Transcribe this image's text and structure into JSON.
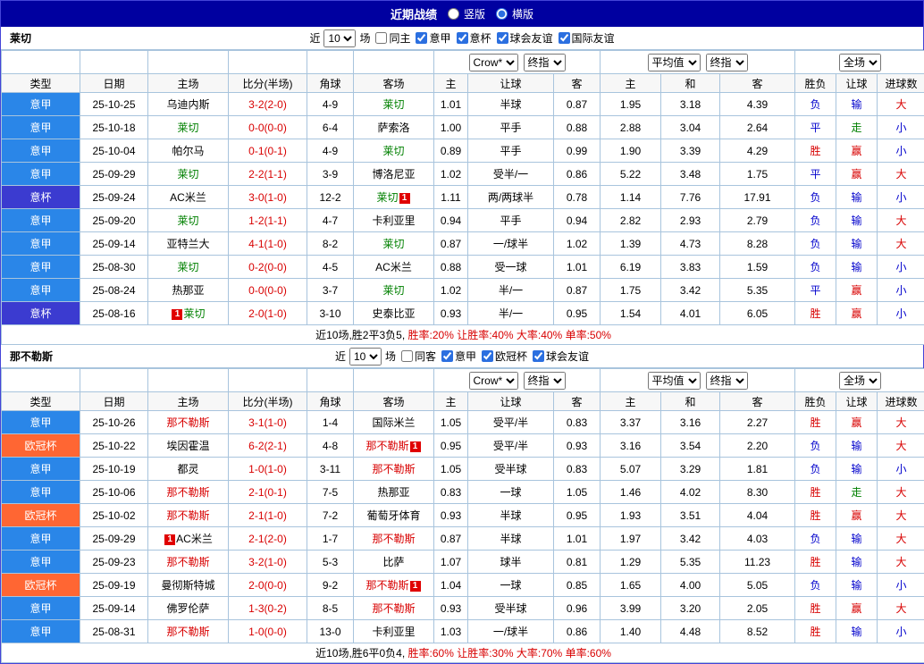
{
  "titlebar": {
    "title": "近期战绩",
    "radios": [
      {
        "label": "竖版",
        "checked": false
      },
      {
        "label": "横版",
        "checked": true
      }
    ]
  },
  "header": {
    "left_cols": [
      "类型",
      "日期",
      "主场",
      "比分(半场)",
      "角球",
      "客场"
    ],
    "select_groups": [
      [
        "Crow*",
        "终指"
      ],
      [
        "平均值",
        "终指"
      ],
      [
        "全场"
      ]
    ],
    "sub_cols": [
      "主",
      "让球",
      "客",
      "主",
      "和",
      "客",
      "胜负",
      "让球",
      "进球数"
    ]
  },
  "colors": {
    "accent_navy": "#0000a0",
    "serie_a_blue": "#2a86e8",
    "coppa_indigo": "#3b3bd0",
    "ucl_orange": "#ff6633",
    "win_red": "#d80000",
    "lose_blue": "#0000cc",
    "team_green": "#008000"
  },
  "sections": [
    {
      "team": "莱切",
      "filter": {
        "near": "近",
        "count": "10",
        "games": "场",
        "checks": [
          {
            "label": "同主",
            "checked": false
          },
          {
            "label": "意甲",
            "checked": true
          },
          {
            "label": "意杯",
            "checked": true
          },
          {
            "label": "球会友谊",
            "checked": true
          },
          {
            "label": "国际友谊",
            "checked": true
          }
        ]
      },
      "rows": [
        {
          "lg": "意甲",
          "date": "25-10-25",
          "home": {
            "n": "乌迪内斯",
            "c": "k"
          },
          "score": "3-2(2-0)",
          "cor": "4-9",
          "away": {
            "n": "莱切",
            "c": "g"
          },
          "o": [
            "1.01",
            "半球",
            "0.87"
          ],
          "avg": [
            "1.95",
            "3.18",
            "4.39"
          ],
          "res": [
            "负",
            "b"
          ],
          "hc": [
            "输",
            "b"
          ],
          "ou": [
            "大",
            "r"
          ]
        },
        {
          "lg": "意甲",
          "date": "25-10-18",
          "home": {
            "n": "莱切",
            "c": "g"
          },
          "score": "0-0(0-0)",
          "cor": "6-4",
          "away": {
            "n": "萨索洛",
            "c": "k"
          },
          "o": [
            "1.00",
            "平手",
            "0.88"
          ],
          "avg": [
            "2.88",
            "3.04",
            "2.64"
          ],
          "res": [
            "平",
            "b"
          ],
          "hc": [
            "走",
            "g"
          ],
          "ou": [
            "小",
            "b"
          ]
        },
        {
          "lg": "意甲",
          "date": "25-10-04",
          "home": {
            "n": "帕尔马",
            "c": "k"
          },
          "score": "0-1(0-1)",
          "cor": "4-9",
          "away": {
            "n": "莱切",
            "c": "g"
          },
          "o": [
            "0.89",
            "平手",
            "0.99"
          ],
          "avg": [
            "1.90",
            "3.39",
            "4.29"
          ],
          "res": [
            "胜",
            "r"
          ],
          "hc": [
            "赢",
            "r"
          ],
          "ou": [
            "小",
            "b"
          ]
        },
        {
          "lg": "意甲",
          "date": "25-09-29",
          "home": {
            "n": "莱切",
            "c": "g"
          },
          "score": "2-2(1-1)",
          "cor": "3-9",
          "away": {
            "n": "博洛尼亚",
            "c": "k"
          },
          "o": [
            "1.02",
            "受半/一",
            "0.86"
          ],
          "avg": [
            "5.22",
            "3.48",
            "1.75"
          ],
          "res": [
            "平",
            "b"
          ],
          "hc": [
            "赢",
            "r"
          ],
          "ou": [
            "大",
            "r"
          ]
        },
        {
          "lg": "意杯",
          "date": "25-09-24",
          "home": {
            "n": "AC米兰",
            "c": "k"
          },
          "score": "3-0(1-0)",
          "cor": "12-2",
          "away": {
            "n": "莱切",
            "c": "g",
            "badge": "1",
            "bpos": "after"
          },
          "o": [
            "1.11",
            "两/两球半",
            "0.78"
          ],
          "avg": [
            "1.14",
            "7.76",
            "17.91"
          ],
          "res": [
            "负",
            "b"
          ],
          "hc": [
            "输",
            "b"
          ],
          "ou": [
            "小",
            "b"
          ]
        },
        {
          "lg": "意甲",
          "date": "25-09-20",
          "home": {
            "n": "莱切",
            "c": "g"
          },
          "score": "1-2(1-1)",
          "cor": "4-7",
          "away": {
            "n": "卡利亚里",
            "c": "k"
          },
          "o": [
            "0.94",
            "平手",
            "0.94"
          ],
          "avg": [
            "2.82",
            "2.93",
            "2.79"
          ],
          "res": [
            "负",
            "b"
          ],
          "hc": [
            "输",
            "b"
          ],
          "ou": [
            "大",
            "r"
          ]
        },
        {
          "lg": "意甲",
          "date": "25-09-14",
          "home": {
            "n": "亚特兰大",
            "c": "k"
          },
          "score": "4-1(1-0)",
          "cor": "8-2",
          "away": {
            "n": "莱切",
            "c": "g"
          },
          "o": [
            "0.87",
            "一/球半",
            "1.02"
          ],
          "avg": [
            "1.39",
            "4.73",
            "8.28"
          ],
          "res": [
            "负",
            "b"
          ],
          "hc": [
            "输",
            "b"
          ],
          "ou": [
            "大",
            "r"
          ]
        },
        {
          "lg": "意甲",
          "date": "25-08-30",
          "home": {
            "n": "莱切",
            "c": "g"
          },
          "score": "0-2(0-0)",
          "cor": "4-5",
          "away": {
            "n": "AC米兰",
            "c": "k"
          },
          "o": [
            "0.88",
            "受一球",
            "1.01"
          ],
          "avg": [
            "6.19",
            "3.83",
            "1.59"
          ],
          "res": [
            "负",
            "b"
          ],
          "hc": [
            "输",
            "b"
          ],
          "ou": [
            "小",
            "b"
          ]
        },
        {
          "lg": "意甲",
          "date": "25-08-24",
          "home": {
            "n": "热那亚",
            "c": "k"
          },
          "score": "0-0(0-0)",
          "cor": "3-7",
          "away": {
            "n": "莱切",
            "c": "g"
          },
          "o": [
            "1.02",
            "半/一",
            "0.87"
          ],
          "avg": [
            "1.75",
            "3.42",
            "5.35"
          ],
          "res": [
            "平",
            "b"
          ],
          "hc": [
            "赢",
            "r"
          ],
          "ou": [
            "小",
            "b"
          ]
        },
        {
          "lg": "意杯",
          "date": "25-08-16",
          "home": {
            "n": "莱切",
            "c": "g",
            "badge": "1",
            "bpos": "before"
          },
          "score": "2-0(1-0)",
          "cor": "3-10",
          "away": {
            "n": "史泰比亚",
            "c": "k"
          },
          "o": [
            "0.93",
            "半/一",
            "0.95"
          ],
          "avg": [
            "1.54",
            "4.01",
            "6.05"
          ],
          "res": [
            "胜",
            "r"
          ],
          "hc": [
            "赢",
            "r"
          ],
          "ou": [
            "小",
            "b"
          ]
        }
      ],
      "summary": {
        "prefix": "近10场,胜2平3负5,",
        "stats": "胜率:20% 让胜率:40% 大率:40% 单率:50%"
      }
    },
    {
      "team": "那不勒斯",
      "filter": {
        "near": "近",
        "count": "10",
        "games": "场",
        "checks": [
          {
            "label": "同客",
            "checked": false
          },
          {
            "label": "意甲",
            "checked": true
          },
          {
            "label": "欧冠杯",
            "checked": true
          },
          {
            "label": "球会友谊",
            "checked": true
          }
        ]
      },
      "rows": [
        {
          "lg": "意甲",
          "date": "25-10-26",
          "home": {
            "n": "那不勒斯",
            "c": "r"
          },
          "score": "3-1(1-0)",
          "cor": "1-4",
          "away": {
            "n": "国际米兰",
            "c": "k"
          },
          "o": [
            "1.05",
            "受平/半",
            "0.83"
          ],
          "avg": [
            "3.37",
            "3.16",
            "2.27"
          ],
          "res": [
            "胜",
            "r"
          ],
          "hc": [
            "赢",
            "r"
          ],
          "ou": [
            "大",
            "r"
          ]
        },
        {
          "lg": "欧冠杯",
          "date": "25-10-22",
          "home": {
            "n": "埃因霍温",
            "c": "k"
          },
          "score": "6-2(2-1)",
          "cor": "4-8",
          "away": {
            "n": "那不勒斯",
            "c": "r",
            "badge": "1",
            "bpos": "after"
          },
          "o": [
            "0.95",
            "受平/半",
            "0.93"
          ],
          "avg": [
            "3.16",
            "3.54",
            "2.20"
          ],
          "res": [
            "负",
            "b"
          ],
          "hc": [
            "输",
            "b"
          ],
          "ou": [
            "大",
            "r"
          ]
        },
        {
          "lg": "意甲",
          "date": "25-10-19",
          "home": {
            "n": "都灵",
            "c": "k"
          },
          "score": "1-0(1-0)",
          "cor": "3-11",
          "away": {
            "n": "那不勒斯",
            "c": "r"
          },
          "o": [
            "1.05",
            "受半球",
            "0.83"
          ],
          "avg": [
            "5.07",
            "3.29",
            "1.81"
          ],
          "res": [
            "负",
            "b"
          ],
          "hc": [
            "输",
            "b"
          ],
          "ou": [
            "小",
            "b"
          ]
        },
        {
          "lg": "意甲",
          "date": "25-10-06",
          "home": {
            "n": "那不勒斯",
            "c": "r"
          },
          "score": "2-1(0-1)",
          "cor": "7-5",
          "away": {
            "n": "热那亚",
            "c": "k"
          },
          "o": [
            "0.83",
            "一球",
            "1.05"
          ],
          "avg": [
            "1.46",
            "4.02",
            "8.30"
          ],
          "res": [
            "胜",
            "r"
          ],
          "hc": [
            "走",
            "g"
          ],
          "ou": [
            "大",
            "r"
          ]
        },
        {
          "lg": "欧冠杯",
          "date": "25-10-02",
          "home": {
            "n": "那不勒斯",
            "c": "r"
          },
          "score": "2-1(1-0)",
          "cor": "7-2",
          "away": {
            "n": "葡萄牙体育",
            "c": "k"
          },
          "o": [
            "0.93",
            "半球",
            "0.95"
          ],
          "avg": [
            "1.93",
            "3.51",
            "4.04"
          ],
          "res": [
            "胜",
            "r"
          ],
          "hc": [
            "赢",
            "r"
          ],
          "ou": [
            "大",
            "r"
          ]
        },
        {
          "lg": "意甲",
          "date": "25-09-29",
          "home": {
            "n": "AC米兰",
            "c": "k",
            "badge": "1",
            "bpos": "before"
          },
          "score": "2-1(2-0)",
          "cor": "1-7",
          "away": {
            "n": "那不勒斯",
            "c": "r"
          },
          "o": [
            "0.87",
            "半球",
            "1.01"
          ],
          "avg": [
            "1.97",
            "3.42",
            "4.03"
          ],
          "res": [
            "负",
            "b"
          ],
          "hc": [
            "输",
            "b"
          ],
          "ou": [
            "大",
            "r"
          ]
        },
        {
          "lg": "意甲",
          "date": "25-09-23",
          "home": {
            "n": "那不勒斯",
            "c": "r"
          },
          "score": "3-2(1-0)",
          "cor": "5-3",
          "away": {
            "n": "比萨",
            "c": "k"
          },
          "o": [
            "1.07",
            "球半",
            "0.81"
          ],
          "avg": [
            "1.29",
            "5.35",
            "11.23"
          ],
          "res": [
            "胜",
            "r"
          ],
          "hc": [
            "输",
            "b"
          ],
          "ou": [
            "大",
            "r"
          ]
        },
        {
          "lg": "欧冠杯",
          "date": "25-09-19",
          "home": {
            "n": "曼彻斯特城",
            "c": "k"
          },
          "score": "2-0(0-0)",
          "cor": "9-2",
          "away": {
            "n": "那不勒斯",
            "c": "r",
            "badge": "1",
            "bpos": "after"
          },
          "o": [
            "1.04",
            "一球",
            "0.85"
          ],
          "avg": [
            "1.65",
            "4.00",
            "5.05"
          ],
          "res": [
            "负",
            "b"
          ],
          "hc": [
            "输",
            "b"
          ],
          "ou": [
            "小",
            "b"
          ]
        },
        {
          "lg": "意甲",
          "date": "25-09-14",
          "home": {
            "n": "佛罗伦萨",
            "c": "k"
          },
          "score": "1-3(0-2)",
          "cor": "8-5",
          "away": {
            "n": "那不勒斯",
            "c": "r"
          },
          "o": [
            "0.93",
            "受半球",
            "0.96"
          ],
          "avg": [
            "3.99",
            "3.20",
            "2.05"
          ],
          "res": [
            "胜",
            "r"
          ],
          "hc": [
            "赢",
            "r"
          ],
          "ou": [
            "大",
            "r"
          ]
        },
        {
          "lg": "意甲",
          "date": "25-08-31",
          "home": {
            "n": "那不勒斯",
            "c": "r"
          },
          "score": "1-0(0-0)",
          "cor": "13-0",
          "away": {
            "n": "卡利亚里",
            "c": "k"
          },
          "o": [
            "1.03",
            "一/球半",
            "0.86"
          ],
          "avg": [
            "1.40",
            "4.48",
            "8.52"
          ],
          "res": [
            "胜",
            "r"
          ],
          "hc": [
            "输",
            "b"
          ],
          "ou": [
            "小",
            "b"
          ]
        }
      ],
      "summary": {
        "prefix": "近10场,胜6平0负4,",
        "stats": "胜率:60% 让胜率:30% 大率:70% 单率:60%"
      }
    }
  ]
}
